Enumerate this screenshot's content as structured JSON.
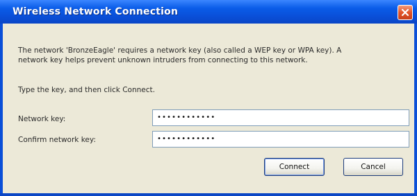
{
  "window": {
    "title": "Wireless Network Connection",
    "close_icon": "close-icon",
    "accent": "#0a4fd8",
    "close_color": "#e2542a"
  },
  "body": {
    "description_line1": "The network 'BronzeEagle' requires a network key (also called a WEP key or WPA key). A",
    "description_line2": "network key helps prevent unknown intruders from connecting to this network.",
    "instruction": "Type the key, and then click Connect.",
    "network_key_label": "Network key:",
    "network_key_value": "••••••••••••",
    "confirm_key_label": "Confirm network key:",
    "confirm_key_value": "••••••••••••"
  },
  "buttons": {
    "connect": "Connect",
    "cancel": "Cancel"
  }
}
